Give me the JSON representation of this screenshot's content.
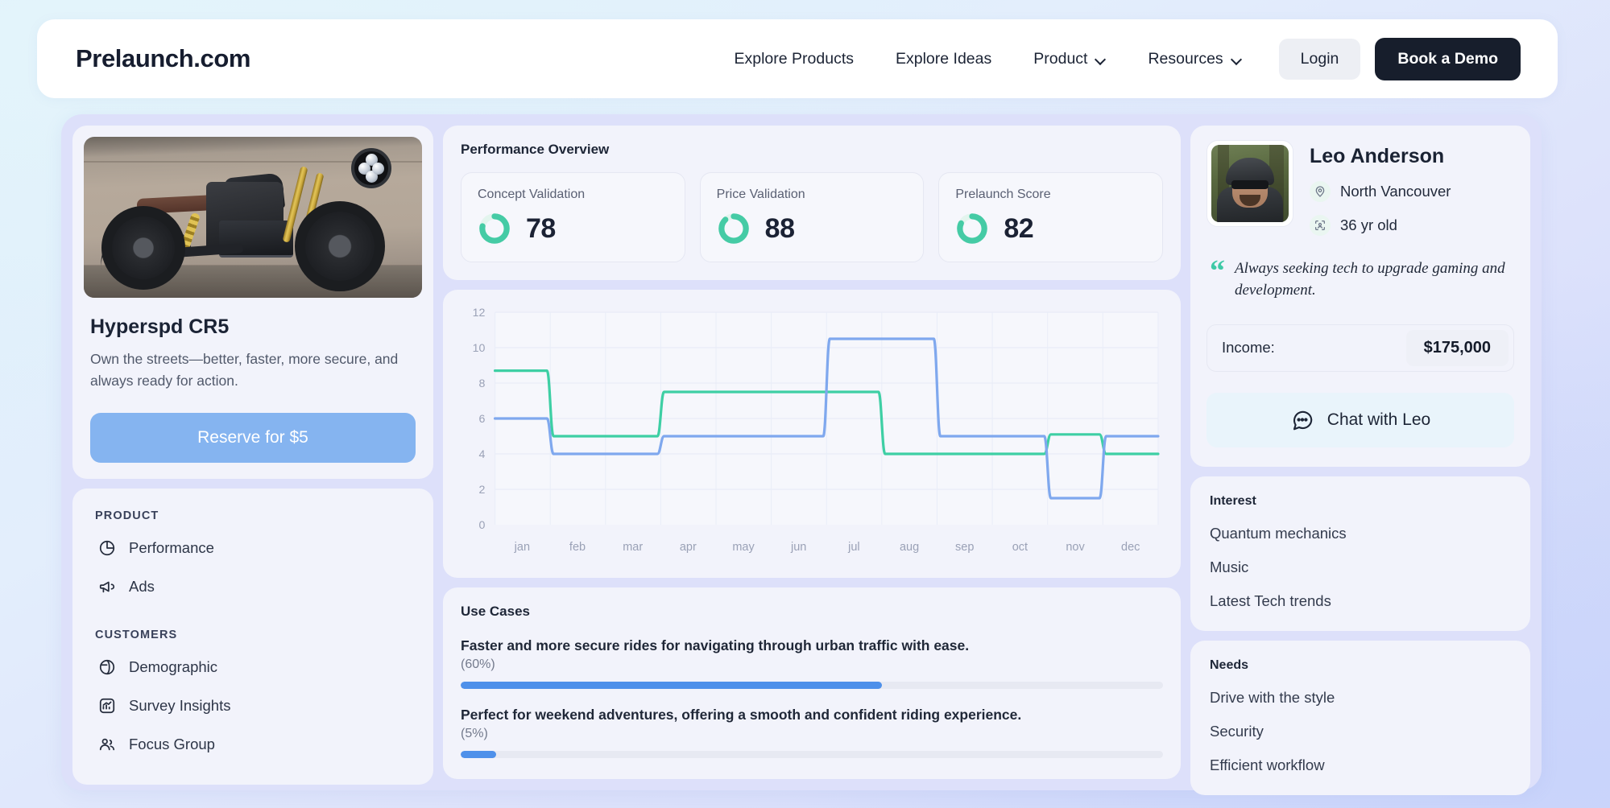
{
  "header": {
    "logo": "Prelaunch.com",
    "nav": [
      {
        "label": "Explore Products",
        "has_chevron": false
      },
      {
        "label": "Explore Ideas",
        "has_chevron": false
      },
      {
        "label": "Product",
        "has_chevron": true
      },
      {
        "label": "Resources",
        "has_chevron": true
      }
    ],
    "login_label": "Login",
    "demo_label": "Book a Demo"
  },
  "product": {
    "title": "Hyperspd CR5",
    "description": "Own the streets—better, faster, more secure, and always ready for action.",
    "reserve_label": "Reserve for $5"
  },
  "sidebar": {
    "groups": [
      {
        "title": "PRODUCT",
        "items": [
          {
            "label": "Performance",
            "icon": "pie-chart-icon"
          },
          {
            "label": "Ads",
            "icon": "megaphone-icon"
          }
        ]
      },
      {
        "title": "CUSTOMERS",
        "items": [
          {
            "label": "Demographic",
            "icon": "globe-icon"
          },
          {
            "label": "Survey Insights",
            "icon": "survey-chart-icon"
          },
          {
            "label": "Focus Group",
            "icon": "people-group-icon"
          }
        ]
      }
    ]
  },
  "performance": {
    "title": "Performance Overview",
    "metrics": [
      {
        "label": "Concept Validation",
        "value": "78",
        "percent": 78
      },
      {
        "label": "Price Validation",
        "value": "88",
        "percent": 88
      },
      {
        "label": "Prelaunch Score",
        "value": "82",
        "percent": 82
      }
    ],
    "gauge_color": "#45cba5",
    "gauge_track": "#e3f5ee"
  },
  "chart_data": {
    "type": "line",
    "title": "",
    "xlabel": "",
    "ylabel": "",
    "categories": [
      "jan",
      "feb",
      "mar",
      "apr",
      "may",
      "jun",
      "jul",
      "aug",
      "sep",
      "oct",
      "nov",
      "dec"
    ],
    "yticks": [
      0,
      2,
      4,
      6,
      8,
      10,
      12
    ],
    "ylim": [
      0,
      12
    ],
    "grid": true,
    "legend": "none",
    "series": [
      {
        "name": "series-green",
        "color": "#3ecfa4",
        "values": [
          8.7,
          5.0,
          5.0,
          7.5,
          7.5,
          7.5,
          7.5,
          4.0,
          4.0,
          4.0,
          5.1,
          4.0
        ]
      },
      {
        "name": "series-blue",
        "color": "#7fa8ee",
        "values": [
          6.0,
          4.0,
          4.0,
          5.0,
          5.0,
          5.0,
          10.5,
          10.5,
          5.0,
          5.0,
          1.5,
          5.0
        ]
      }
    ]
  },
  "use_cases": {
    "title": "Use Cases",
    "items": [
      {
        "text": "Faster and more secure rides for navigating through urban traffic with ease.",
        "percent_label": "(60%)",
        "percent": 60
      },
      {
        "text": "Perfect for weekend adventures, offering a smooth and confident riding experience.",
        "percent_label": "(5%)",
        "percent": 5
      }
    ],
    "bar_color": "#4e90ea"
  },
  "profile": {
    "name": "Leo Anderson",
    "location": "North Vancouver",
    "age": "36 yr old",
    "quote": "Always seeking tech to upgrade gaming and development.",
    "income_label": "Income:",
    "income_value": "$175,000",
    "chat_label": "Chat with Leo"
  },
  "interest": {
    "title": "Interest",
    "items": [
      "Quantum mechanics",
      "Music",
      "Latest Tech trends"
    ]
  },
  "needs": {
    "title": "Needs",
    "items": [
      "Drive with the style",
      "Security",
      "Efficient workflow"
    ]
  }
}
